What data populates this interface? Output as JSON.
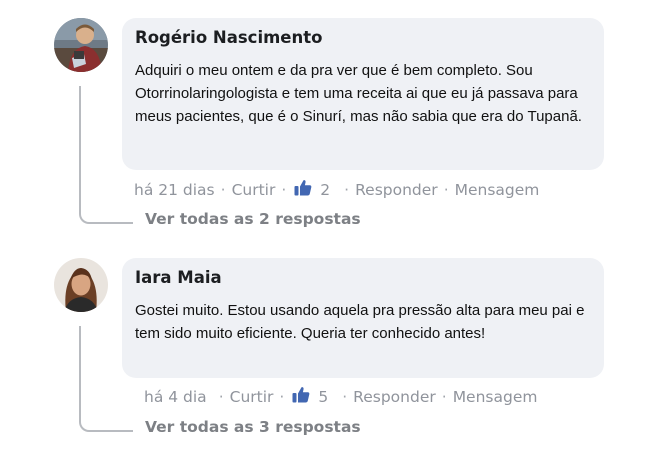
{
  "comments": [
    {
      "author": "Rogério Nascimento",
      "text": "Adquiri o meu ontem e da pra ver que é bem completo. Sou Otorrinolaringologista e tem uma receita ai que eu já passava para meus pacientes, que é o Sinurí, mas não sabia que era do Tupanã.",
      "time": "há 21 dias",
      "like_label": "Curtir",
      "like_count": "2",
      "reply_label": "Responder",
      "message_label": "Mensagem",
      "view_replies": "Ver todas as 2 respostas",
      "avatar": "man-avatar",
      "separator": "·"
    },
    {
      "author": "Iara Maia",
      "text": "Gostei muito. Estou usando aquela pra pressão alta para meu pai e tem sido muito eficiente. Queria ter conhecido antes!",
      "time": "há 4 dia",
      "like_label": "Curtir",
      "like_count": "5",
      "reply_label": "Responder",
      "message_label": "Mensagem",
      "view_replies": "Ver todas as 3 respostas",
      "avatar": "woman-avatar",
      "separator": "·"
    }
  ],
  "colors": {
    "bubble": "#eff1f5",
    "meta_text": "#90949c",
    "like_blue": "#4267b2",
    "connector": "#b8bbc0"
  }
}
